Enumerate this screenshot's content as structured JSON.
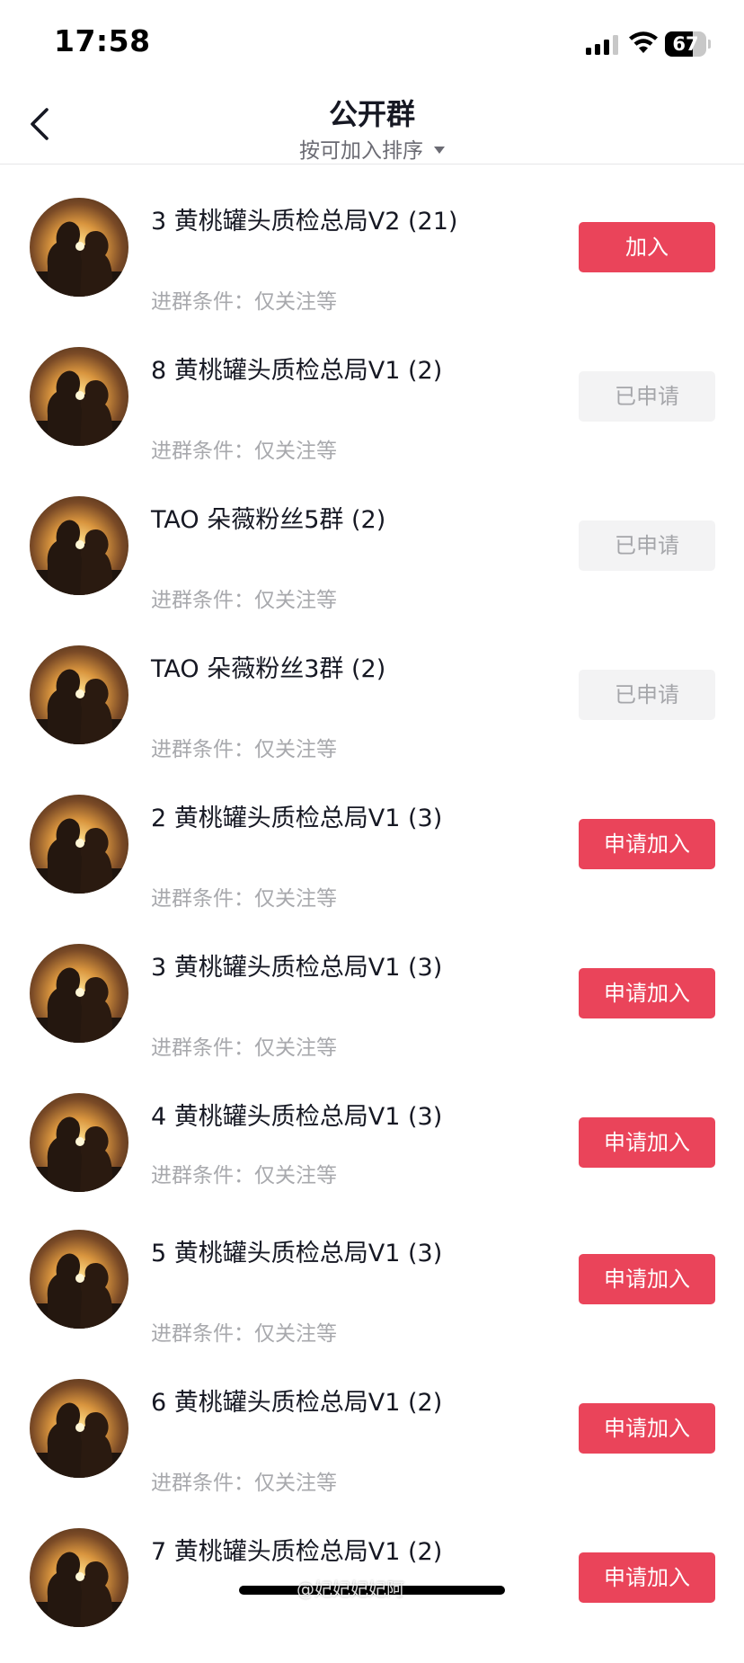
{
  "status_bar": {
    "time": "17:58",
    "battery": "67",
    "icons": [
      "signal-icon",
      "wifi-icon",
      "battery-icon"
    ]
  },
  "header": {
    "title": "公开群",
    "sort_label": "按可加入排序",
    "icons": [
      "back-arrow-icon",
      "caret-down-icon"
    ]
  },
  "colors": {
    "accent": "#ea445a",
    "disabled_bg": "#f3f3f4",
    "text_primary": "#161823",
    "text_secondary": "#a8a9ad"
  },
  "groups": [
    {
      "name": "3 黄桃罐头质检总局V2 (21)",
      "condition": "进群条件：仅关注等",
      "button": "加入",
      "state": "join"
    },
    {
      "name": "8 黄桃罐头质检总局V1 (2)",
      "condition": "进群条件：仅关注等",
      "button": "已申请",
      "state": "applied"
    },
    {
      "name": "TAO 朵薇粉丝5群 (2)",
      "condition": "进群条件：仅关注等",
      "button": "已申请",
      "state": "applied"
    },
    {
      "name": "TAO 朵薇粉丝3群 (2)",
      "condition": "进群条件：仅关注等",
      "button": "已申请",
      "state": "applied"
    },
    {
      "name": "2 黄桃罐头质检总局V1 (3)",
      "condition": "进群条件：仅关注等",
      "button": "申请加入",
      "state": "request"
    },
    {
      "name": "3 黄桃罐头质检总局V1 (3)",
      "condition": "进群条件：仅关注等",
      "button": "申请加入",
      "state": "request"
    },
    {
      "name": "4 黄桃罐头质检总局V1 (3)",
      "condition": "进群条件：仅关注等",
      "button": "申请加入",
      "state": "request"
    },
    {
      "name": "5 黄桃罐头质检总局V1 (3)",
      "condition": "进群条件：仅关注等",
      "button": "申请加入",
      "state": "request"
    },
    {
      "name": "6 黄桃罐头质检总局V1 (2)",
      "condition": "进群条件：仅关注等",
      "button": "申请加入",
      "state": "request"
    },
    {
      "name": "7 黄桃罐头质检总局V1 (2)",
      "condition": "",
      "button": "申请加入",
      "state": "request"
    }
  ],
  "watermark": "@妃妃妃妃阿"
}
